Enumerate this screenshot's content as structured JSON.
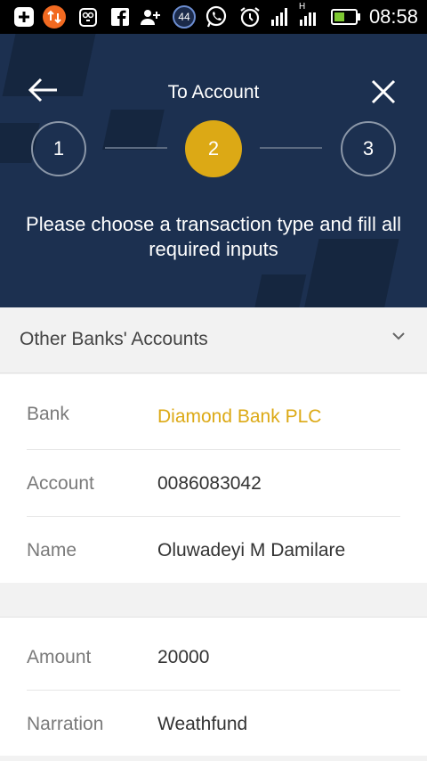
{
  "status_bar": {
    "time": "08:58",
    "notification_count": "44",
    "signal_label": "H"
  },
  "header": {
    "title": "To Account",
    "steps": [
      "1",
      "2",
      "3"
    ],
    "active_step": 2,
    "instruction": "Please choose a transaction type and fill all required inputs"
  },
  "transaction_type": {
    "selected": "Other Banks' Accounts"
  },
  "account_details": {
    "bank_label": "Bank",
    "bank_value": "Diamond Bank PLC",
    "account_label": "Account",
    "account_value": "0086083042",
    "name_label": "Name",
    "name_value": "Oluwadeyi M Damilare"
  },
  "transfer_details": {
    "amount_label": "Amount",
    "amount_value": "20000",
    "narration_label": "Narration",
    "narration_value": "Weathfund"
  },
  "colors": {
    "header_bg": "#1c3050",
    "accent": "#dca915",
    "page_bg": "#f2f2f2"
  }
}
